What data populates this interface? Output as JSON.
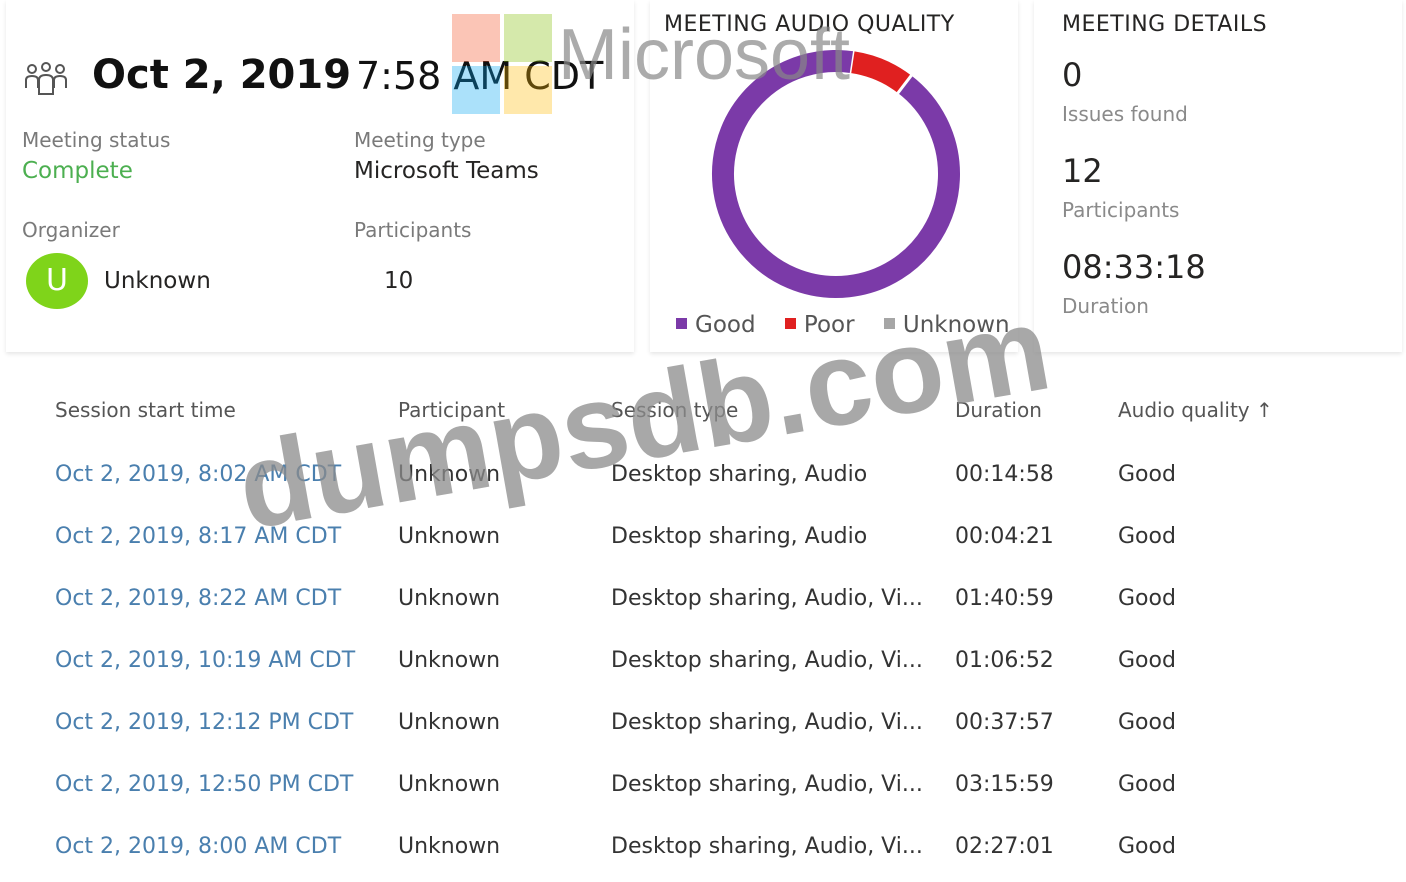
{
  "summary": {
    "date": "Oct 2, 2019",
    "time": "7:58 AM CDT",
    "status_label": "Meeting status",
    "status_value": "Complete",
    "type_label": "Meeting type",
    "type_value": "Microsoft Teams",
    "organizer_label": "Organizer",
    "organizer_initial": "U",
    "organizer_name": "Unknown",
    "participants_label": "Participants",
    "participants_value": "10"
  },
  "audio_quality": {
    "heading": "MEETING AUDIO QUALITY",
    "legend": [
      {
        "label": "Good",
        "color": "#7b3aa8"
      },
      {
        "label": "Poor",
        "color": "#e02020"
      },
      {
        "label": "Unknown",
        "color": "#a6a6a6"
      }
    ],
    "chart_data": {
      "type": "pie",
      "categories": [
        "Good",
        "Poor",
        "Unknown"
      ],
      "values": [
        92,
        8,
        0
      ],
      "colors": [
        "#7b3aa8",
        "#e02020",
        "#a6a6a6"
      ]
    }
  },
  "details": {
    "heading": "MEETING DETAILS",
    "issues_value": "0",
    "issues_label": "Issues found",
    "participants_value": "12",
    "participants_label": "Participants",
    "duration_value": "08:33:18",
    "duration_label": "Duration"
  },
  "table": {
    "columns": [
      "Session start time",
      "Participant",
      "Session type",
      "Duration",
      "Audio quality ↑"
    ],
    "rows": [
      [
        "Oct 2, 2019, 8:02 AM CDT",
        "Unknown",
        "Desktop sharing, Audio",
        "00:14:58",
        "Good"
      ],
      [
        "Oct 2, 2019, 8:17 AM CDT",
        "Unknown",
        "Desktop sharing, Audio",
        "00:04:21",
        "Good"
      ],
      [
        "Oct 2, 2019, 8:22 AM CDT",
        "Unknown",
        "Desktop sharing, Audio, Vi...",
        "01:40:59",
        "Good"
      ],
      [
        "Oct 2, 2019, 10:19 AM CDT",
        "Unknown",
        "Desktop sharing, Audio, Vi...",
        "01:06:52",
        "Good"
      ],
      [
        "Oct 2, 2019, 12:12 PM CDT",
        "Unknown",
        "Desktop sharing, Audio, Vi...",
        "00:37:57",
        "Good"
      ],
      [
        "Oct 2, 2019, 12:50 PM CDT",
        "Unknown",
        "Desktop sharing, Audio, Vi...",
        "03:15:59",
        "Good"
      ],
      [
        "Oct 2, 2019, 8:00 AM CDT",
        "Unknown",
        "Desktop sharing, Audio, Vi...",
        "02:27:01",
        "Good"
      ]
    ]
  },
  "watermarks": {
    "brand": "Microsoft",
    "site": "dumpsdb.com"
  }
}
